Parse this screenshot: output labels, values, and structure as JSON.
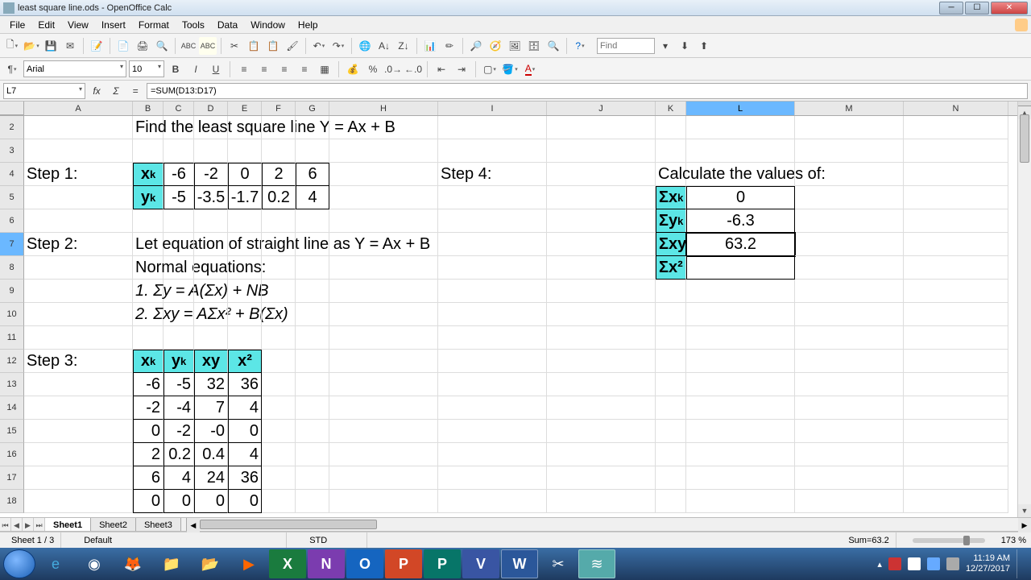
{
  "title": "least square line.ods - OpenOffice Calc",
  "menus": [
    "File",
    "Edit",
    "View",
    "Insert",
    "Format",
    "Tools",
    "Data",
    "Window",
    "Help"
  ],
  "find_placeholder": "Find",
  "font": {
    "name": "Arial",
    "size": "10"
  },
  "cell_ref": "L7",
  "formula": "=SUM(D13:D17)",
  "columns": [
    "A",
    "B",
    "C",
    "D",
    "E",
    "F",
    "G",
    "H",
    "I",
    "J",
    "K",
    "L",
    "M",
    "N"
  ],
  "rows_shown": [
    "2",
    "3",
    "4",
    "5",
    "6",
    "7",
    "8",
    "9",
    "10",
    "11",
    "12",
    "13",
    "14",
    "15",
    "16",
    "17",
    "18"
  ],
  "sheet_tabs": [
    "Sheet1",
    "Sheet2",
    "Sheet3"
  ],
  "status": {
    "pages": "Sheet 1 / 3",
    "style": "Default",
    "mode": "STD",
    "sum": "Sum=63.2",
    "zoom": "173 %"
  },
  "clock": {
    "time": "11:19 AM",
    "date": "12/27/2017"
  },
  "cells": {
    "B2": "Find the least square line Y = Ax + B",
    "A4": "Step 1:",
    "B4h": "x",
    "B4s": "k",
    "C4": "-6",
    "D4": "-2",
    "E4": "0",
    "F4": "2",
    "G4": "6",
    "B5h": "y",
    "B5s": "k",
    "C5": "-5",
    "D5": "-3.5",
    "E5": "-1.7",
    "F5": "0.2",
    "G5": "4",
    "A7": "Step 2:",
    "B7": "Let equation of straight line as Y = Ax + B",
    "B8": "Normal equations:",
    "B9": "1. Σy = A(Σx) + NB",
    "B10": "2. Σxy = AΣx² + B(Σx)",
    "A12": "Step 3:",
    "B12h": "x",
    "B12s": "k",
    "C12h": "y",
    "C12s": "k",
    "D12": "xy",
    "E12": "x²",
    "t3": {
      "r13": [
        "-6",
        "-5",
        "32",
        "36"
      ],
      "r14": [
        "-2",
        "-4",
        "7",
        "4"
      ],
      "r15": [
        "0",
        "-2",
        "-0",
        "0"
      ],
      "r16": [
        "2",
        "0.2",
        "0.4",
        "4"
      ],
      "r17": [
        "6",
        "4",
        "24",
        "36"
      ],
      "r18": [
        "0",
        "0",
        "0",
        "0"
      ]
    },
    "I4": "Step 4:",
    "K4": "Calculate the values of:",
    "K5h": "Σx",
    "K5s": "k",
    "L5": "0",
    "K6h": "Σy",
    "K6s": "k",
    "L6": "-6.3",
    "K7": "Σxy",
    "L7": "63.2",
    "K8": "Σx²"
  }
}
